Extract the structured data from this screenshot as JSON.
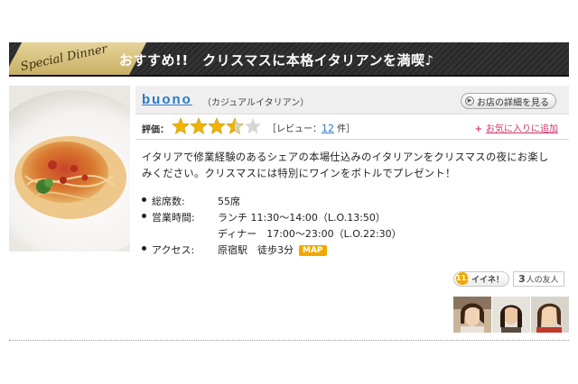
{
  "banner": {
    "badge_text": "Special Dinner",
    "title": "おすすめ!!　クリスマスに本格イタリアンを満喫♪"
  },
  "shop": {
    "name": "buono",
    "genre": "（カジュアルイタリアン）",
    "detail_button": "お店の詳細を見る",
    "rating_label": "評価：",
    "rating_value": 3.5,
    "rating_max": 5,
    "review_prefix": "［レビュー：",
    "review_count": "12",
    "review_suffix": " 件］",
    "favorite_link": "お気に入りに追加"
  },
  "description": "イタリアで修業経験のあるシェアの本場仕込みのイタリアンをクリスマスの夜にお楽しみください。クリスマスには特別にワインをボトルでプレゼント！",
  "info": {
    "seats_label": "総席数:",
    "seats_value": "55席",
    "hours_label": "営業時間:",
    "hours_lunch": "ランチ 11:30〜14:00（L.O.13:50）",
    "hours_dinner": "ディナー　17:00〜23:00（L.O.22:30）",
    "access_label": "アクセス:",
    "access_value": "原宿駅　徒歩3分",
    "map_label": "MAP"
  },
  "social": {
    "like_icon_text": "111",
    "like_label": "イイネ！",
    "friends_count": "3",
    "friends_label": "人の友人"
  },
  "colors": {
    "link": "#2a79c9",
    "favorite": "#d0356b",
    "star": "#f0b400",
    "map_badge": "#f0a800",
    "banner_bg": "#2a2a2a"
  }
}
